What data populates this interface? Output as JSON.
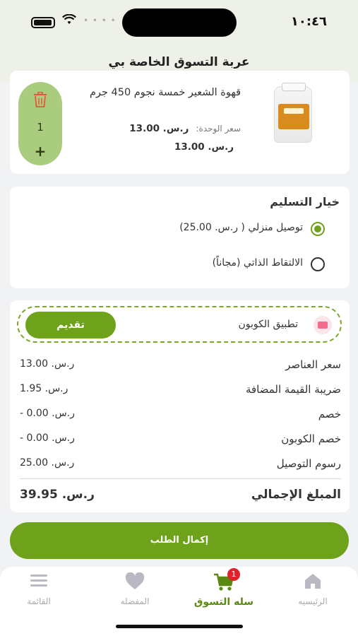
{
  "status_bar": {
    "time": "١٠:٤٦"
  },
  "header": {
    "title": "عربة التسوق الخاصة بي"
  },
  "cart_item": {
    "name": "قهوة الشعير خمسة نجوم 450 جرم",
    "unit_price_label": "سعر الوحدة:",
    "unit_price": "ر.س. 13.00",
    "line_total": "ر.س. 13.00",
    "quantity": "1",
    "plus": "+"
  },
  "delivery": {
    "title": "خيار التسليم",
    "options": [
      {
        "label": "توصيل منزلي ( ر.س. 25.00)",
        "selected": true
      },
      {
        "label": "الالتقاط الذاتي (مجاناً)",
        "selected": false
      }
    ]
  },
  "coupon": {
    "label": "تطبيق الكوبون",
    "apply_button": "تقديم"
  },
  "summary": {
    "rows": [
      {
        "label": "سعر العناصر",
        "value": "ر.س. 13.00"
      },
      {
        "label": "ضريبة القيمة المضافة",
        "value": "ر.س. 1.95"
      },
      {
        "label": "خصم",
        "value": "ر.س. 0.00 -"
      },
      {
        "label": "خصم الكوبون",
        "value": "ر.س. 0.00 -"
      },
      {
        "label": "رسوم التوصيل",
        "value": "ر.س. 25.00"
      }
    ],
    "total_label": "المبلغ الإجمالي",
    "total_value": "ر.س. 39.95"
  },
  "checkout_button": "إكمال الطلب",
  "bottom_nav": {
    "items": [
      {
        "label": "القائمة",
        "icon": "menu-icon"
      },
      {
        "label": "المفضله",
        "icon": "heart-icon"
      },
      {
        "label": "سله التسوق",
        "icon": "cart-icon",
        "active": true,
        "badge": "1"
      },
      {
        "label": "الرئيسيه",
        "icon": "home-icon"
      }
    ]
  },
  "colors": {
    "accent": "#6fa21b",
    "qty_pill": "#a9cc7e",
    "header_bg": "#eef1e8",
    "badge": "#e0222b"
  }
}
